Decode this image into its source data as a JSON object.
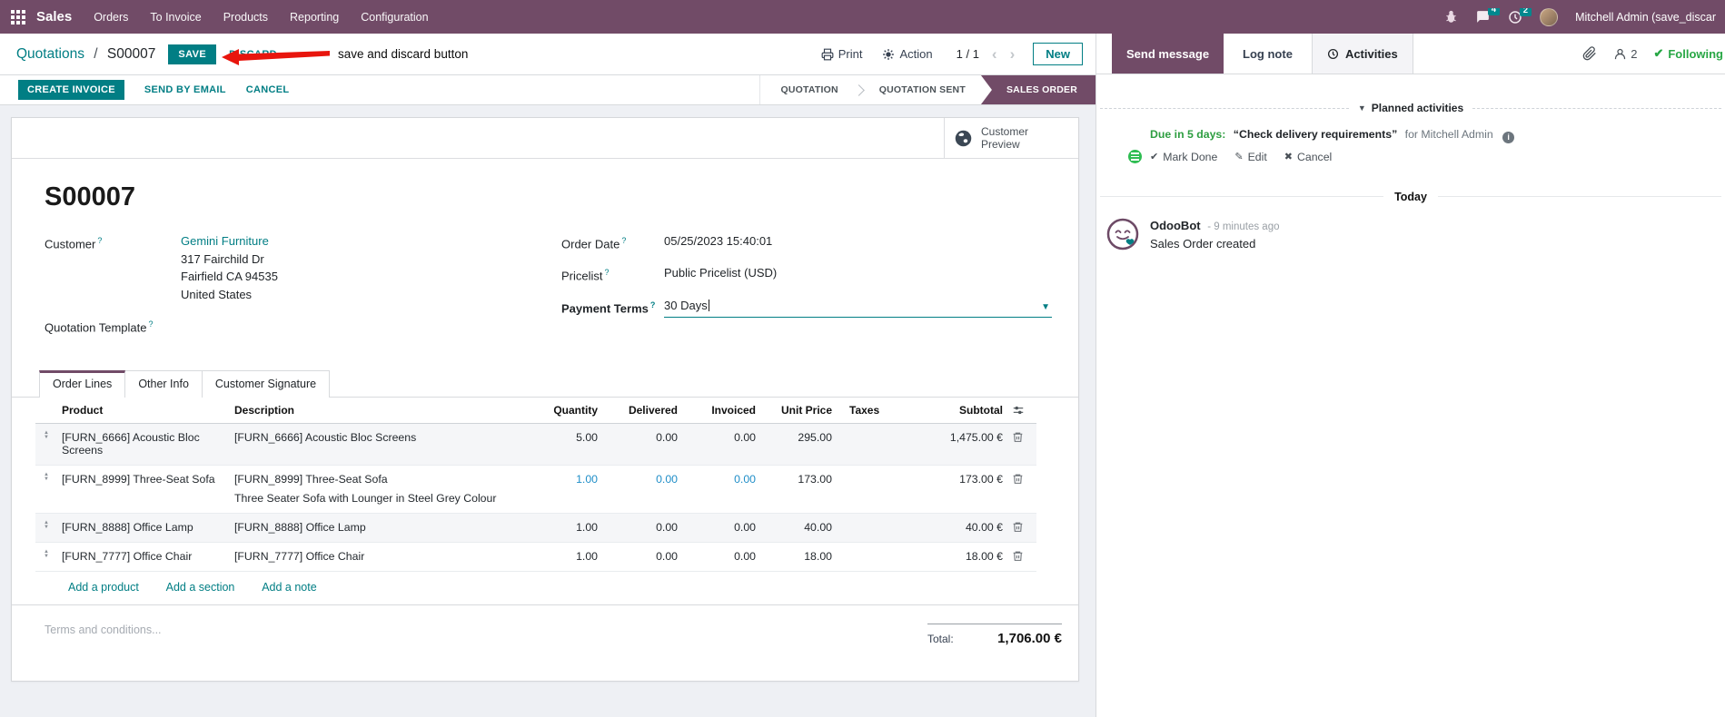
{
  "colors": {
    "brand": "#714B67",
    "accent": "#017E84",
    "success": "#28a745",
    "annotation_red": "#e8150d",
    "modified_blue": "#1f8ec8"
  },
  "navbar": {
    "app_name": "Sales",
    "menus": [
      "Orders",
      "To Invoice",
      "Products",
      "Reporting",
      "Configuration"
    ],
    "message_badge": "4",
    "activity_badge": "2",
    "user_name": "Mitchell Admin (save_discar"
  },
  "breadcrumb": {
    "parent": "Quotations",
    "separator": "/",
    "current": "S00007",
    "save_label": "SAVE",
    "discard_label": "DISCARD"
  },
  "annotation": {
    "text": "save and discard button"
  },
  "control_panel": {
    "print_label": "Print",
    "action_label": "Action",
    "pager_value": "1 / 1",
    "new_label": "New"
  },
  "statusbar": {
    "create_invoice": "CREATE INVOICE",
    "send_by_email": "SEND BY EMAIL",
    "cancel": "CANCEL",
    "states": [
      {
        "label": "QUOTATION",
        "active": false
      },
      {
        "label": "QUOTATION SENT",
        "active": false
      },
      {
        "label": "SALES ORDER",
        "active": true
      }
    ]
  },
  "sheet": {
    "customer_preview_label": "Customer Preview",
    "title": "S00007",
    "help_marker": "?",
    "fields": {
      "customer": {
        "label": "Customer",
        "name": "Gemini Furniture",
        "address": [
          "317 Fairchild Dr",
          "Fairfield CA 94535",
          "United States"
        ]
      },
      "quotation_template": {
        "label": "Quotation Template"
      },
      "order_date": {
        "label": "Order Date",
        "value": "05/25/2023 15:40:01"
      },
      "pricelist": {
        "label": "Pricelist",
        "value": "Public Pricelist (USD)"
      },
      "payment_terms": {
        "label": "Payment Terms",
        "value": "30 Days"
      }
    },
    "tabs": [
      {
        "label": "Order Lines"
      },
      {
        "label": "Other Info"
      },
      {
        "label": "Customer Signature"
      }
    ],
    "order_lines": {
      "columns": [
        "Product",
        "Description",
        "Quantity",
        "Delivered",
        "Invoiced",
        "Unit Price",
        "Taxes",
        "Subtotal"
      ],
      "rows": [
        {
          "product": "[FURN_6666] Acoustic Bloc Screens",
          "description": "[FURN_6666] Acoustic Bloc Screens",
          "quantity": "5.00",
          "delivered": "0.00",
          "invoiced": "0.00",
          "unit_price": "295.00",
          "taxes": "",
          "subtotal": "1,475.00 €"
        },
        {
          "product": "[FURN_8999] Three-Seat Sofa",
          "description": "[FURN_8999] Three-Seat Sofa",
          "description2": "Three Seater Sofa with Lounger in Steel Grey Colour",
          "quantity": "1.00",
          "delivered": "0.00",
          "invoiced": "0.00",
          "unit_price": "173.00",
          "taxes": "",
          "subtotal": "173.00 €"
        },
        {
          "product": "[FURN_8888] Office Lamp",
          "description": "[FURN_8888] Office Lamp",
          "quantity": "1.00",
          "delivered": "0.00",
          "invoiced": "0.00",
          "unit_price": "40.00",
          "taxes": "",
          "subtotal": "40.00 €"
        },
        {
          "product": "[FURN_7777] Office Chair",
          "description": "[FURN_7777] Office Chair",
          "quantity": "1.00",
          "delivered": "0.00",
          "invoiced": "0.00",
          "unit_price": "18.00",
          "taxes": "",
          "subtotal": "18.00 €"
        }
      ],
      "footer_links": [
        "Add a product",
        "Add a section",
        "Add a note"
      ]
    },
    "terms_placeholder": "Terms and conditions...",
    "total": {
      "label": "Total:",
      "value": "1,706.00 €"
    }
  },
  "chatter": {
    "send_message": "Send message",
    "log_note": "Log note",
    "activities": "Activities",
    "followers_count": "2",
    "following_label": "Following",
    "planned": {
      "section_label": "Planned activities",
      "activity": {
        "due": "Due in 5 days:",
        "summary": "“Check delivery requirements”",
        "for_text": "for Mitchell Admin",
        "mark_done": "Mark Done",
        "edit": "Edit",
        "cancel": "Cancel"
      }
    },
    "timeline": {
      "day_label": "Today",
      "message": {
        "author": "OdooBot",
        "time": "- 9 minutes ago",
        "body": "Sales Order created"
      }
    }
  }
}
